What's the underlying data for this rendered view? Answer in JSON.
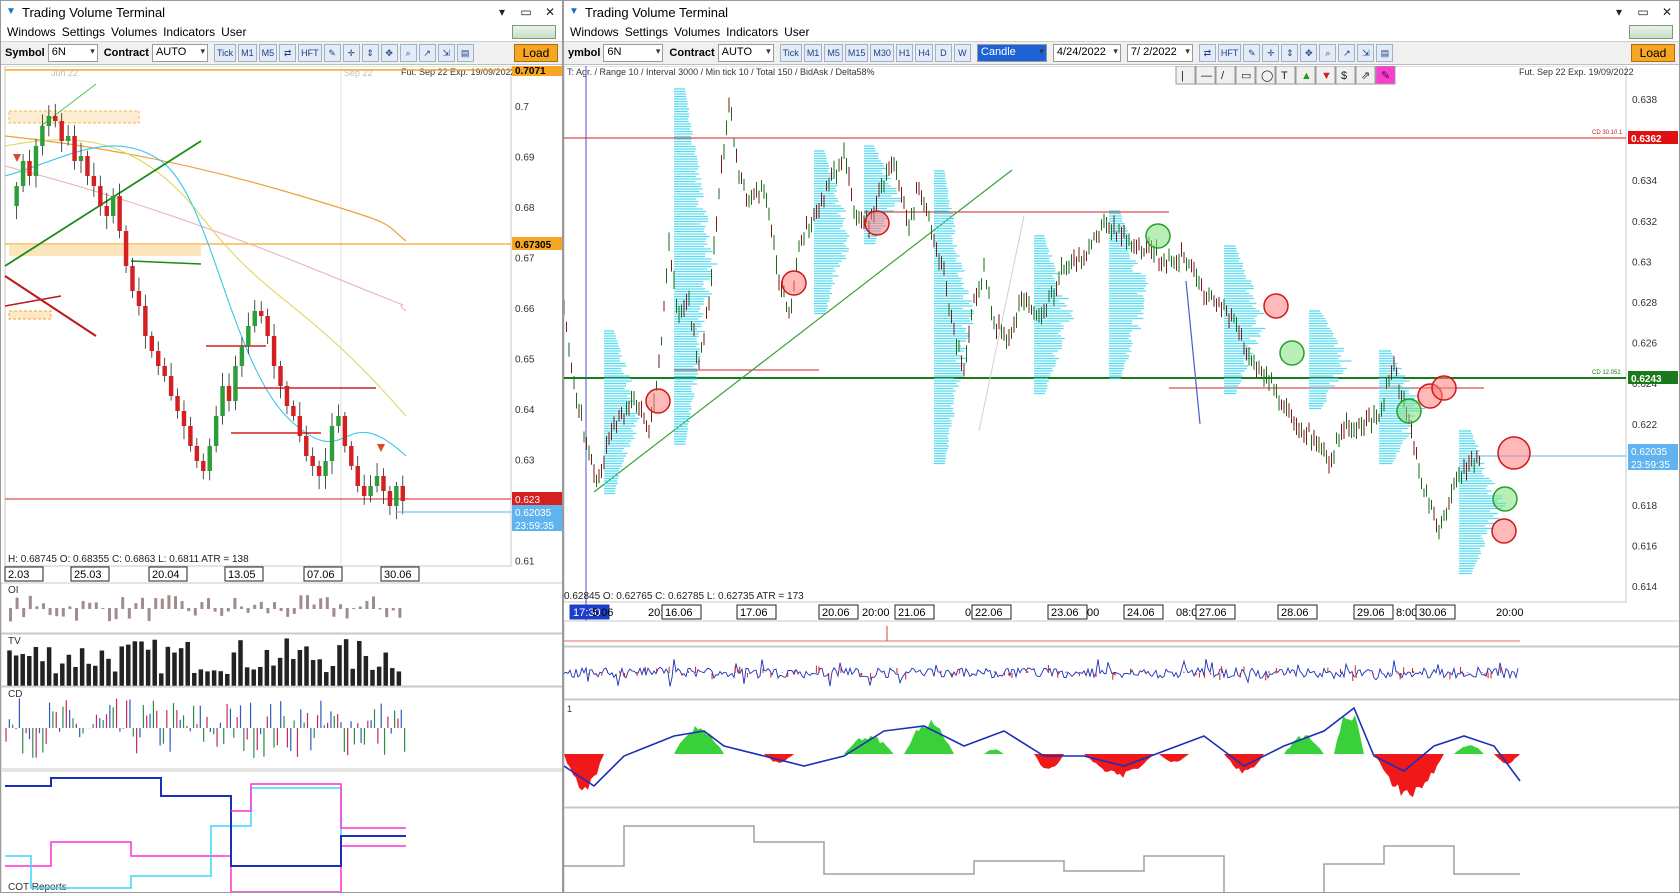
{
  "left_window": {
    "title": "Trading Volume Terminal",
    "controls": [
      "▾",
      "▭",
      "✕"
    ],
    "menu": [
      "Windows",
      "Settings",
      "Volumes",
      "Indicators",
      "User"
    ],
    "toolbar": {
      "symbol_label": "Symbol",
      "symbol_value": "6N",
      "contract_label": "Contract",
      "contract_value": "AUTO",
      "buttons": [
        "Tick",
        "M1",
        "M5",
        "⇄",
        "HFT",
        "✎",
        "✛",
        "⇕",
        "✥",
        "⌕",
        "↗",
        "⇲",
        "▤"
      ],
      "load_label": "Load"
    },
    "chart": {
      "contract_info": "Fut. Sep 22 Exp. 19/09/2022",
      "month_labels": [
        "Jun 22",
        "Sep 22"
      ],
      "price_ticks": [
        "0.7",
        "0.69",
        "0.68",
        "0.67",
        "0.66",
        "0.65",
        "0.64",
        "0.63",
        "0.62",
        "0.61"
      ],
      "price_tags": {
        "top": "0.7071",
        "mid": "0.67305",
        "red": "0.623",
        "current": "0.62035",
        "timer": "23:59:35"
      },
      "ohlc_label": "H: 0.68745  O: 0.68355  C: 0.6863  L: 0.6811  ATR = 138",
      "date_labels": [
        "2.03",
        "25.03",
        "20.04",
        "13.05",
        "07.06",
        "30.06"
      ],
      "panels": [
        "OI",
        "TV",
        "CD",
        "COT Reports"
      ]
    }
  },
  "right_window": {
    "title": "Trading Volume Terminal",
    "controls": [
      "▾",
      "▭",
      "✕"
    ],
    "menu": [
      "Windows",
      "Settings",
      "Volumes",
      "Indicators",
      "User"
    ],
    "toolbar": {
      "symbol_label": "ymbol",
      "symbol_value": "6N",
      "contract_label": "Contract",
      "contract_value": "AUTO",
      "tf_buttons": [
        "Tick",
        "M1",
        "M5",
        "M15",
        "M30",
        "H1",
        "H4",
        "D",
        "W"
      ],
      "chart_type": "Candle",
      "date_from": "4/24/2022",
      "date_to": "7/ 2/2022",
      "tool_buttons": [
        "⇄",
        "HFT",
        "✎",
        "✛",
        "⇕",
        "✥",
        "⌕",
        "↗",
        "⇲",
        "▤"
      ],
      "load_label": "Load"
    },
    "chart": {
      "settings_info": "T: Agr. / Range 10 / Interval 3000 / Min tick 10 / Total 150 / BidAsk / Delta58%",
      "contract_info": "Fut. Sep 22 Exp. 19/09/2022",
      "price_ticks": [
        "0.638",
        "0.636",
        "0.634",
        "0.632",
        "0.63",
        "0.628",
        "0.626",
        "0.624",
        "0.622",
        "0.62",
        "0.618",
        "0.616",
        "0.614"
      ],
      "price_tags": {
        "red": "0.6362",
        "green": "0.6243",
        "current": "0.62035",
        "timer": "23:59:35"
      },
      "cd_labels": [
        "CD 30.10.1",
        "CD 12.052"
      ],
      "ohlc_label": "0.62845  O: 0.62765  C: 0.62785  L: 0.62735  ATR = 173",
      "time_labels": [
        "17:30",
        "5.06",
        "20:",
        "16.06",
        "17.06",
        "20.06",
        "20:00",
        "21.06",
        "0",
        "22.06",
        "23.06",
        "00",
        "24.06",
        "08:00",
        "27.06",
        "28.06",
        "29.06",
        "8:00",
        "30.06",
        "20:00"
      ],
      "drawing_tools": [
        "|",
        "—",
        "/",
        "▭",
        "◯",
        "T",
        "▲",
        "▼",
        "$",
        "⇗",
        "✎"
      ],
      "panel_label": "1"
    }
  },
  "colors": {
    "bull": "#2e9e3a",
    "bear": "#d42020",
    "profile": "#38d6f2",
    "accent_orange": "#f5a623",
    "price_blue": "#5fb3ee"
  }
}
